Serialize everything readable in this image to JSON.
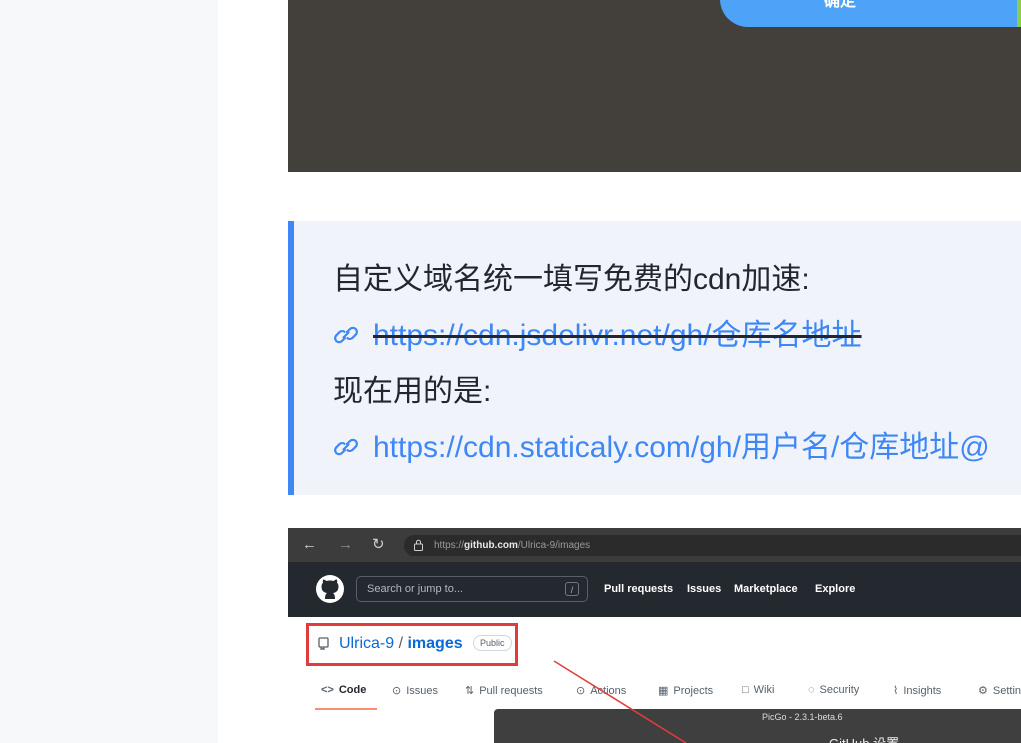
{
  "top_screenshot": {
    "confirm_label": "确定"
  },
  "quote": {
    "line1": "自定义域名统一填写免费的cdn加速:",
    "link1": "https://cdn.jsdelivr.net/gh/仓库名地址",
    "line3": "现在用的是:",
    "link2": "https://cdn.staticaly.com/gh/用户名/仓库地址@"
  },
  "browser": {
    "url_prefix": "https://",
    "url_domain": "github.com",
    "url_path": "/Ulrica-9/images",
    "search_placeholder": "Search or jump to...",
    "search_key": "/",
    "nav": [
      "Pull requests",
      "Issues",
      "Marketplace",
      "Explore"
    ],
    "repo_owner": "Ulrica-9",
    "repo_sep": "/",
    "repo_name": "images",
    "badge": "Public",
    "tabs": [
      "Code",
      "Issues",
      "Pull requests",
      "Actions",
      "Projects",
      "Wiki",
      "Security",
      "Insights",
      "Settings"
    ],
    "popup_title": "PicGo - 2.3.1-beta.6",
    "popup_subtitle": "GitHub 设置"
  },
  "colors": {
    "accent": "#3f87f5",
    "highlight_box": "#e03c3c"
  }
}
